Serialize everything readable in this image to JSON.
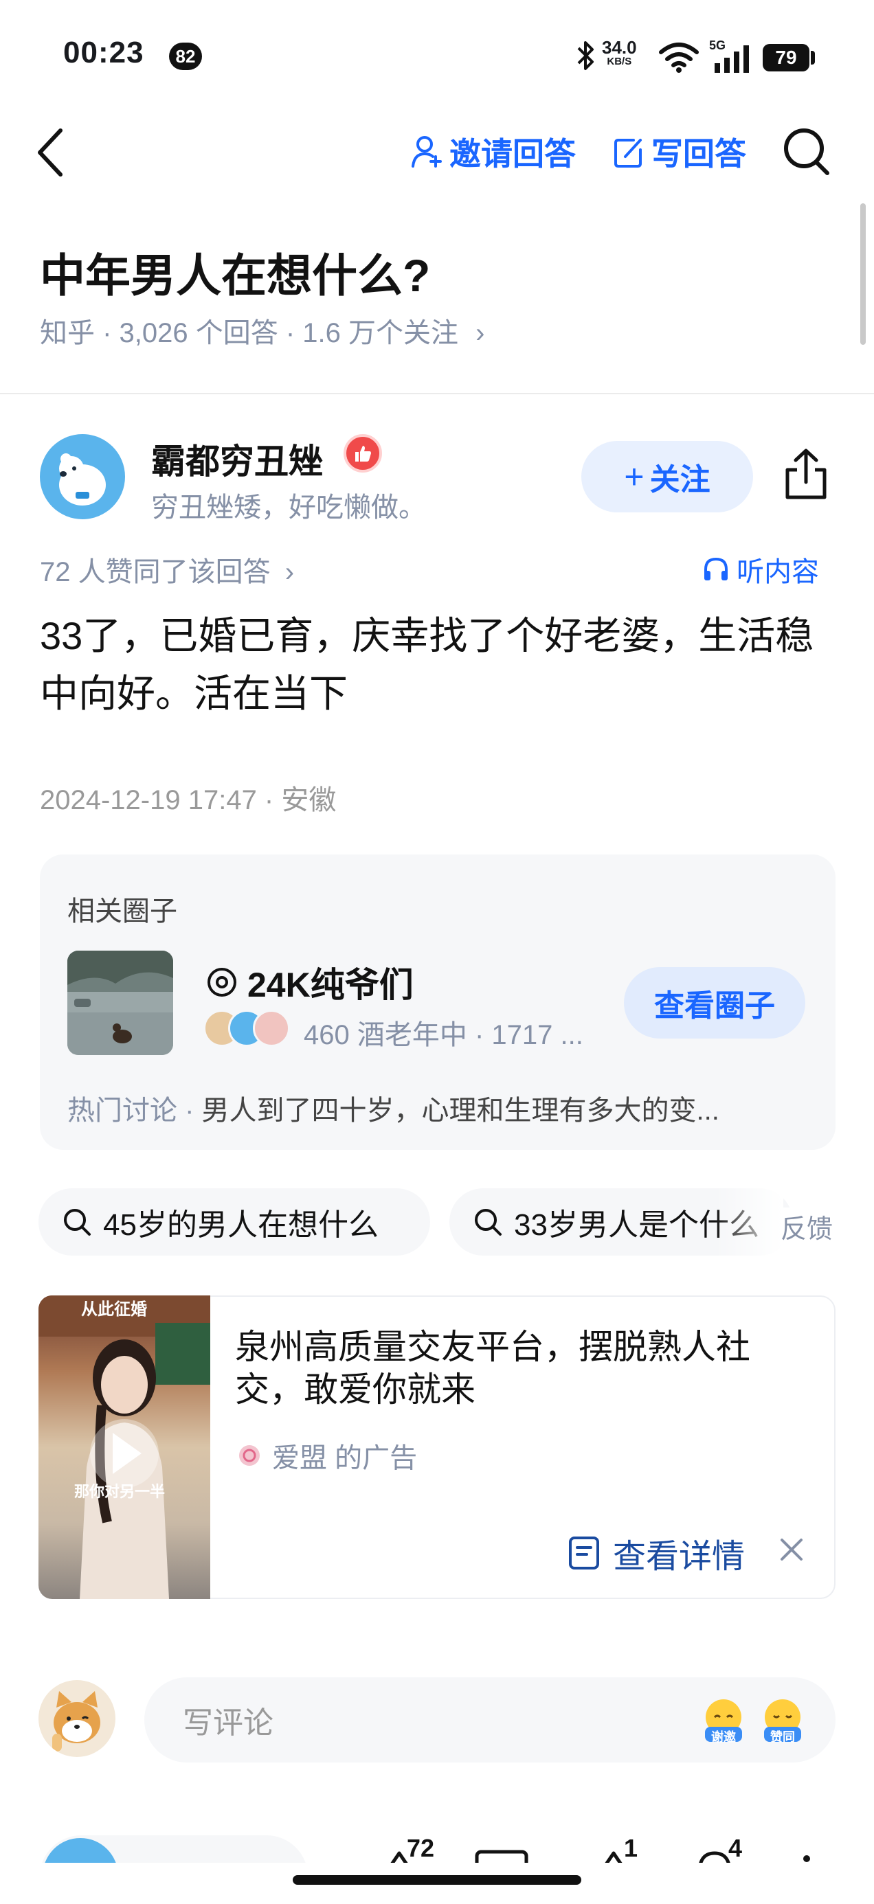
{
  "status_bar": {
    "time": "00:23",
    "notification_count": "82",
    "net_speed": "34.0",
    "net_speed_unit": "KB/S",
    "network": "5G",
    "battery": "79"
  },
  "nav": {
    "invite_label": "邀请回答",
    "write_label": "写回答"
  },
  "question": {
    "title": "中年男人在想什么?",
    "meta": "知乎 · 3,026 个回答 · 1.6 万个关注"
  },
  "author": {
    "name": "霸都穷丑矬",
    "bio": "穷丑矬矮，好吃懒做。",
    "follow_label": "关注"
  },
  "answer": {
    "vote_meta": "72 人赞同了该回答",
    "listen_label": "听内容",
    "text": "33了，已婚已育，庆幸找了个好老婆，生活稳中向好。活在当下",
    "date": "2024-12-19 17:47 · 安徽"
  },
  "circle": {
    "section_label": "相关圈子",
    "name": "24K纯爷们",
    "stats": "460 酒老年中 · 1717 ...",
    "view_label": "查看圈子",
    "hot_prefix": "热门讨论 · ",
    "hot_topic": "男人到了四十岁，心理和生理有多大的变..."
  },
  "related_searches": [
    {
      "label": "45岁的男人在想什么"
    },
    {
      "label": "33岁男人是个什么"
    }
  ],
  "feedback_label": "反馈",
  "ad": {
    "video_caption_top": "从此征婚",
    "video_caption_bottom": "那你对另一半",
    "title": "泉州高质量交友平台，摆脱熟人社交，敢爱你就来",
    "source": "爱盟 的广告",
    "details_label": "查看详情"
  },
  "comment": {
    "placeholder": "写评论",
    "emoji_thanks": "谢邀",
    "emoji_agree": "赞同"
  },
  "bottom_bar": {
    "vote_count": "72",
    "favorite_count": "1",
    "comment_count": "4"
  },
  "colors": {
    "accent": "#1a66ff",
    "muted": "#8590a6",
    "card_bg": "#f6f7f9"
  }
}
